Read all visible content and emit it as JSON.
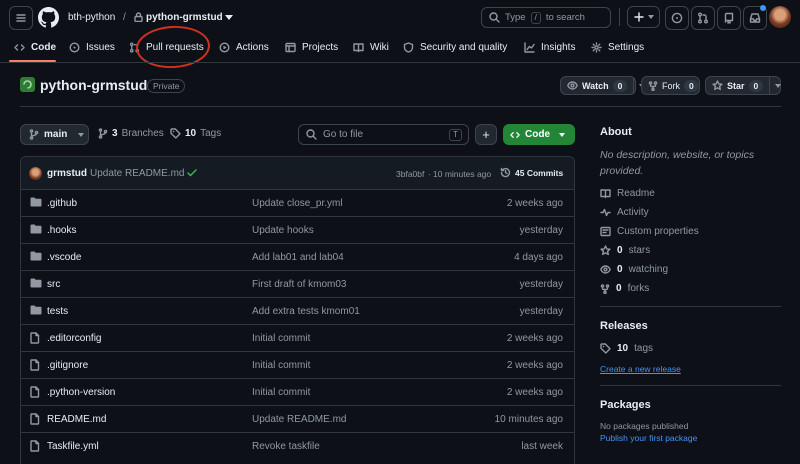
{
  "topbar": {
    "owner": "bth-python",
    "separator": "/",
    "repo": "python-grmstud",
    "search_prefix": "Type",
    "search_key": "/",
    "search_suffix": "to search"
  },
  "tabs": [
    {
      "label": "Code"
    },
    {
      "label": "Issues"
    },
    {
      "label": "Pull requests"
    },
    {
      "label": "Actions"
    },
    {
      "label": "Projects"
    },
    {
      "label": "Wiki"
    },
    {
      "label": "Security and quality"
    },
    {
      "label": "Insights"
    },
    {
      "label": "Settings"
    }
  ],
  "repo_header": {
    "name": "python-grmstud",
    "visibility": "Private",
    "watch_label": "Watch",
    "watch_count": "0",
    "fork_label": "Fork",
    "fork_count": "0",
    "star_label": "Star",
    "star_count": "0"
  },
  "toolbar": {
    "branch": "main",
    "branches_count": "3",
    "branches_label": "Branches",
    "tags_count": "10",
    "tags_label": "Tags",
    "goto_placeholder": "Go to file",
    "goto_key": "T",
    "add_label": "+",
    "code_label": "Code"
  },
  "commit": {
    "author": "grmstud",
    "message": "Update README.md",
    "hash": "3bfa0bf",
    "dot": "·",
    "time": "10 minutes ago",
    "commits_label": "45 Commits"
  },
  "files": [
    {
      "name": ".github",
      "type": "dir",
      "message": "Update close_pr.yml",
      "date": "2 weeks ago"
    },
    {
      "name": ".hooks",
      "type": "dir",
      "message": "Update hooks",
      "date": "yesterday"
    },
    {
      "name": ".vscode",
      "type": "dir",
      "message": "Add lab01 and lab04",
      "date": "4 days ago"
    },
    {
      "name": "src",
      "type": "dir",
      "message": "First draft of kmom03",
      "date": "yesterday"
    },
    {
      "name": "tests",
      "type": "dir",
      "message": "Add extra tests kmom01",
      "date": "yesterday"
    },
    {
      "name": ".editorconfig",
      "type": "file",
      "message": "Initial commit",
      "date": "2 weeks ago"
    },
    {
      "name": ".gitignore",
      "type": "file",
      "message": "Initial commit",
      "date": "2 weeks ago"
    },
    {
      "name": ".python-version",
      "type": "file",
      "message": "Initial commit",
      "date": "2 weeks ago"
    },
    {
      "name": "README.md",
      "type": "file",
      "message": "Update README.md",
      "date": "10 minutes ago"
    },
    {
      "name": "Taskfile.yml",
      "type": "file",
      "message": "Revoke taskfile",
      "date": "last week"
    }
  ],
  "about": {
    "heading": "About",
    "description": "No description, website, or topics provided.",
    "readme": "Readme",
    "activity": "Activity",
    "custom_properties": "Custom properties",
    "stars_count": "0",
    "stars_label": "stars",
    "watching_count": "0",
    "watching_label": "watching",
    "forks_count": "0",
    "forks_label": "forks"
  },
  "releases": {
    "heading": "Releases",
    "tags_count": "10",
    "tags_label": "tags",
    "create_link": "Create a new release"
  },
  "packages": {
    "heading": "Packages",
    "none_text": "No packages published",
    "publish_link": "Publish your first package"
  },
  "colors": {
    "background": "#0d1117",
    "accent_green": "#238636",
    "link_blue": "#4493f8",
    "annotation_red": "#d0311f"
  }
}
